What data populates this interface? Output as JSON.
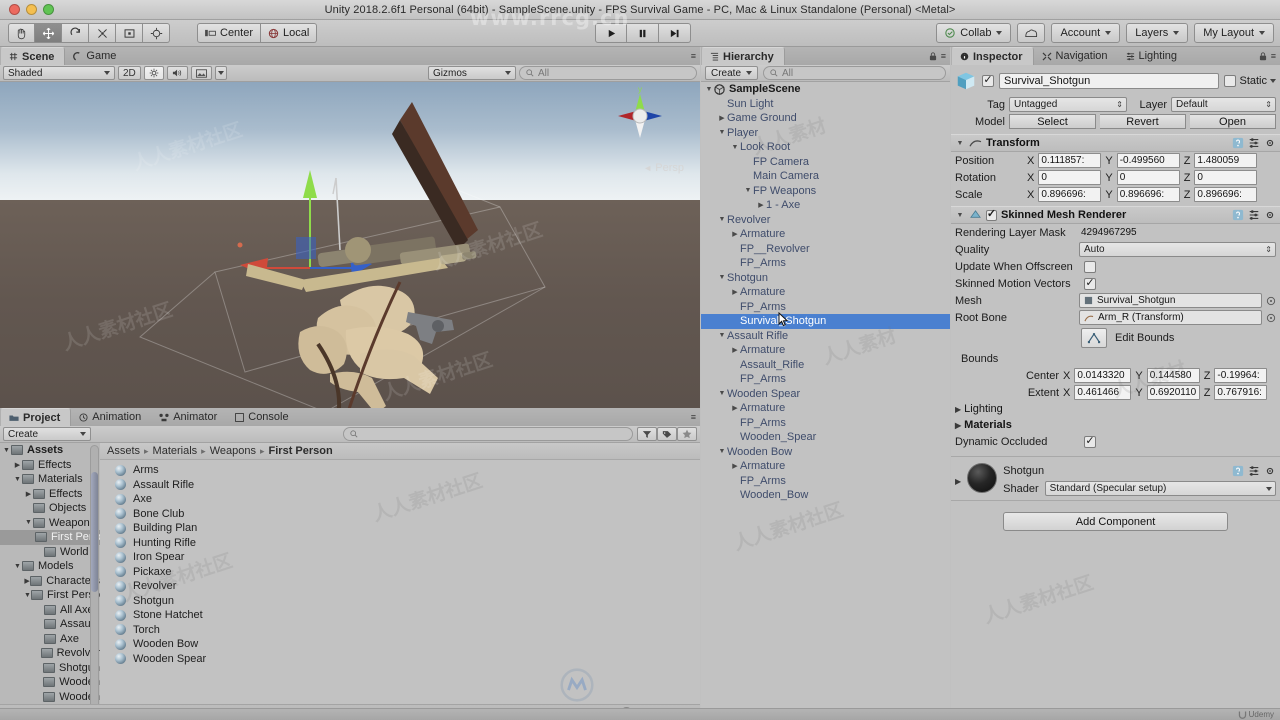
{
  "window": {
    "title": "Unity 2018.2.6f1 Personal (64bit) - SampleScene.unity - FPS Survival Game - PC, Mac & Linux Standalone (Personal) <Metal>"
  },
  "toolbar": {
    "tools": [
      {
        "name": "hand-tool",
        "glyph": "✋"
      },
      {
        "name": "move-tool",
        "glyph": "✛"
      },
      {
        "name": "rotate-tool",
        "glyph": "↻"
      },
      {
        "name": "scale-tool",
        "glyph": "⤡"
      },
      {
        "name": "rect-tool",
        "glyph": "▣"
      },
      {
        "name": "transform-tool",
        "glyph": "✥"
      }
    ],
    "pivot_label": "Center",
    "space_label": "Local",
    "play_label": "▶",
    "pause_label": "❚❚",
    "step_label": "▶❚",
    "collab_label": "Collab",
    "cloud_label": "☁",
    "account_label": "Account",
    "layers_label": "Layers",
    "layout_label": "My Layout"
  },
  "scene": {
    "tabs": [
      {
        "label": "Scene",
        "selected": true,
        "icon": "grid-icon"
      },
      {
        "label": "Game",
        "selected": false,
        "icon": "gamepad-icon"
      }
    ],
    "draw_mode": "Shaded",
    "two_d": "2D",
    "light_icon": "☀",
    "audio_icon": "🔊",
    "fx_icon": "▣",
    "gizmos_label": "Gizmos",
    "search_placeholder": "All",
    "perspective_label": "Persp",
    "axis_y": "y"
  },
  "hierarchy": {
    "tab_label": "Hierarchy",
    "create_label": "Create",
    "search_placeholder": "All",
    "items": [
      {
        "label": "SampleScene",
        "depth": 0,
        "arrow": "down",
        "root": true
      },
      {
        "label": "Sun Light",
        "depth": 1,
        "arrow": "none"
      },
      {
        "label": "Game Ground",
        "depth": 1,
        "arrow": "right"
      },
      {
        "label": "Player",
        "depth": 1,
        "arrow": "down"
      },
      {
        "label": "Look Root",
        "depth": 2,
        "arrow": "down"
      },
      {
        "label": "FP Camera",
        "depth": 3,
        "arrow": "none"
      },
      {
        "label": "Main Camera",
        "depth": 3,
        "arrow": "none"
      },
      {
        "label": "FP Weapons",
        "depth": 3,
        "arrow": "down"
      },
      {
        "label": "1 - Axe",
        "depth": 4,
        "arrow": "right"
      },
      {
        "label": "Revolver",
        "depth": 1,
        "arrow": "down"
      },
      {
        "label": "Armature",
        "depth": 2,
        "arrow": "right"
      },
      {
        "label": "FP__Revolver",
        "depth": 2,
        "arrow": "none"
      },
      {
        "label": "FP_Arms",
        "depth": 2,
        "arrow": "none"
      },
      {
        "label": "Shotgun",
        "depth": 1,
        "arrow": "down"
      },
      {
        "label": "Armature",
        "depth": 2,
        "arrow": "right"
      },
      {
        "label": "FP_Arms",
        "depth": 2,
        "arrow": "none"
      },
      {
        "label": "Survival_Shotgun",
        "depth": 2,
        "arrow": "none",
        "selected": true
      },
      {
        "label": "Assault Rifle",
        "depth": 1,
        "arrow": "down"
      },
      {
        "label": "Armature",
        "depth": 2,
        "arrow": "right"
      },
      {
        "label": "Assault_Rifle",
        "depth": 2,
        "arrow": "none"
      },
      {
        "label": "FP_Arms",
        "depth": 2,
        "arrow": "none"
      },
      {
        "label": "Wooden Spear",
        "depth": 1,
        "arrow": "down"
      },
      {
        "label": "Armature",
        "depth": 2,
        "arrow": "right"
      },
      {
        "label": "FP_Arms",
        "depth": 2,
        "arrow": "none"
      },
      {
        "label": "Wooden_Spear",
        "depth": 2,
        "arrow": "none"
      },
      {
        "label": "Wooden Bow",
        "depth": 1,
        "arrow": "down"
      },
      {
        "label": "Armature",
        "depth": 2,
        "arrow": "right"
      },
      {
        "label": "FP_Arms",
        "depth": 2,
        "arrow": "none"
      },
      {
        "label": "Wooden_Bow",
        "depth": 2,
        "arrow": "none"
      }
    ]
  },
  "inspector": {
    "tabs": [
      {
        "label": "Inspector",
        "selected": true,
        "icon": "info-icon"
      },
      {
        "label": "Navigation",
        "selected": false,
        "icon": "nav-icon"
      },
      {
        "label": "Lighting",
        "selected": false,
        "icon": "lighting-icon"
      }
    ],
    "object_name": "Survival_Shotgun",
    "object_enabled": true,
    "static_label": "Static",
    "tag_label": "Tag",
    "tag_value": "Untagged",
    "layer_label": "Layer",
    "layer_value": "Default",
    "model_label": "Model",
    "model_buttons": [
      "Select",
      "Revert",
      "Open"
    ],
    "transform": {
      "title": "Transform",
      "rows": [
        {
          "label": "Position",
          "x": "0.111857:",
          "y": "-0.499560",
          "z": "1.480059"
        },
        {
          "label": "Rotation",
          "x": "0",
          "y": "0",
          "z": "0"
        },
        {
          "label": "Scale",
          "x": "0.896696:",
          "y": "0.896696:",
          "z": "0.896696:"
        }
      ]
    },
    "skinned_mesh_renderer": {
      "title": "Skinned Mesh Renderer",
      "enabled": true,
      "rendering_layer_mask_label": "Rendering Layer Mask",
      "rendering_layer_mask_value": "4294967295",
      "quality_label": "Quality",
      "quality_value": "Auto",
      "update_offscreen_label": "Update When Offscreen",
      "update_offscreen_checked": false,
      "skinned_motion_label": "Skinned Motion Vectors",
      "skinned_motion_checked": true,
      "mesh_label": "Mesh",
      "mesh_value": "Survival_Shotgun",
      "root_bone_label": "Root Bone",
      "root_bone_value": "Arm_R (Transform)",
      "edit_bounds_label": "Edit Bounds",
      "bounds_label": "Bounds",
      "center_label": "Center",
      "center": {
        "x": "0.0143320",
        "y": "0.144580",
        "z": "-0.19964:"
      },
      "extent_label": "Extent",
      "extent": {
        "x": "0.461466",
        "y": "0.6920110",
        "z": "0.767916:"
      },
      "lighting_label": "Lighting",
      "materials_label": "Materials",
      "dynamic_occluded_label": "Dynamic Occluded",
      "dynamic_occluded_checked": true
    },
    "material": {
      "name": "Shotgun",
      "shader_label": "Shader",
      "shader_value": "Standard (Specular setup)"
    },
    "add_component_label": "Add Component"
  },
  "project": {
    "tabs": [
      {
        "label": "Project",
        "selected": true,
        "icon": "folder-icon"
      },
      {
        "label": "Animation",
        "selected": false,
        "icon": "clock-icon"
      },
      {
        "label": "Animator",
        "selected": false,
        "icon": "animator-icon"
      },
      {
        "label": "Console",
        "selected": false,
        "icon": "console-icon"
      }
    ],
    "create_label": "Create",
    "search_placeholder": "",
    "breadcrumb": [
      "Assets",
      "Materials",
      "Weapons",
      "First Person"
    ],
    "tree": [
      {
        "label": "Assets",
        "depth": 0,
        "arrow": "down",
        "bold": true
      },
      {
        "label": "Effects",
        "depth": 1,
        "arrow": "right"
      },
      {
        "label": "Materials",
        "depth": 1,
        "arrow": "down"
      },
      {
        "label": "Effects",
        "depth": 2,
        "arrow": "right"
      },
      {
        "label": "Objects",
        "depth": 2,
        "arrow": "none"
      },
      {
        "label": "Weapons",
        "depth": 2,
        "arrow": "down"
      },
      {
        "label": "First Person",
        "depth": 3,
        "arrow": "none",
        "selected": true
      },
      {
        "label": "World",
        "depth": 3,
        "arrow": "none"
      },
      {
        "label": "Models",
        "depth": 1,
        "arrow": "down"
      },
      {
        "label": "Characters",
        "depth": 2,
        "arrow": "right"
      },
      {
        "label": "First Person",
        "depth": 2,
        "arrow": "down"
      },
      {
        "label": "All Axe",
        "depth": 3,
        "arrow": "none"
      },
      {
        "label": "Assault",
        "depth": 3,
        "arrow": "none"
      },
      {
        "label": "Axe",
        "depth": 3,
        "arrow": "none"
      },
      {
        "label": "Revolver",
        "depth": 3,
        "arrow": "none"
      },
      {
        "label": "Shotgun",
        "depth": 3,
        "arrow": "none"
      },
      {
        "label": "Wooden",
        "depth": 3,
        "arrow": "none"
      },
      {
        "label": "Wooden",
        "depth": 3,
        "arrow": "none"
      }
    ],
    "assets": [
      "Arms",
      "Assault Rifle",
      "Axe",
      "Bone Club",
      "Building Plan",
      "Hunting Rifle",
      "Iron Spear",
      "Pickaxe",
      "Revolver",
      "Shotgun",
      "Stone Hatchet",
      "Torch",
      "Wooden Bow",
      "Wooden Spear"
    ]
  },
  "status": {
    "udemy_label": "Udemy"
  },
  "watermarks": {
    "site": "www.rrcg.cn",
    "cn": "人人素材社区"
  },
  "colors": {
    "selection_blue": "#4a80d0",
    "panel_gray": "#c2c2c2",
    "hierarchy_text": "#3f4c6b",
    "axis_x": "#c0392b",
    "axis_y": "#7ed321",
    "axis_z": "#2f5fd0"
  }
}
